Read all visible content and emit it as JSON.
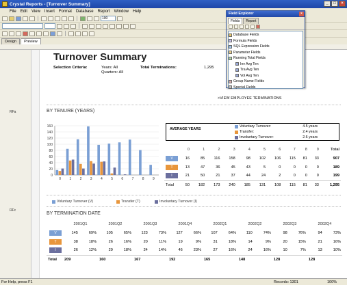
{
  "window": {
    "title": "Crystal Reports - [Turnover Summary]"
  },
  "menu": [
    "File",
    "Edit",
    "View",
    "Insert",
    "Format",
    "Database",
    "Report",
    "Window",
    "Help"
  ],
  "toolbar": {
    "zoom_value": "100"
  },
  "tabs": [
    "Design",
    "Preview"
  ],
  "side_labels": {
    "rfa": "RFa",
    "rfc": "RFc"
  },
  "report": {
    "title": "Turnover Summary",
    "criteria_label": "Selection Criteria:",
    "years": "Years: All",
    "quarters": "Quarters: All",
    "total_term_label": "Total Terminations:",
    "total_term_value": "1,295",
    "view_link": ">VIEW EMPLOYEE TERMINATIONS",
    "tenure_heading": "BY TENURE (YEARS)",
    "termdate_heading": "BY TERMINATION DATE"
  },
  "average": {
    "title": "AVERAGE YEARS",
    "rows": [
      {
        "label": "Voluntary Turnover:",
        "value": "4.5 years"
      },
      {
        "label": "Transfer:",
        "value": "2.4 years"
      },
      {
        "label": "Involuntary Turnover:",
        "value": "2.6 years"
      }
    ]
  },
  "tenure_table": {
    "headers": [
      "0",
      "1",
      "2",
      "3",
      "4",
      "5",
      "6",
      "7",
      "8",
      "9",
      "Total"
    ],
    "rows": [
      {
        "cat": "V",
        "values": [
          "16",
          "85",
          "116",
          "158",
          "98",
          "102",
          "106",
          "115",
          "81",
          "33",
          "907"
        ]
      },
      {
        "cat": "T",
        "values": [
          "13",
          "47",
          "36",
          "45",
          "43",
          "5",
          "0",
          "0",
          "0",
          "0",
          "189"
        ]
      },
      {
        "cat": "I",
        "values": [
          "21",
          "50",
          "21",
          "37",
          "44",
          "24",
          "2",
          "0",
          "0",
          "0",
          "199"
        ]
      }
    ],
    "total_label": "Total",
    "totals": [
      "50",
      "182",
      "173",
      "240",
      "185",
      "131",
      "108",
      "115",
      "81",
      "33",
      "1,295"
    ]
  },
  "legend": [
    {
      "label": "Voluntary Turnover (V)",
      "color": "#7a9fd4"
    },
    {
      "label": "Transfer (T)",
      "color": "#e8963c"
    },
    {
      "label": "Involuntary Turnover (I)",
      "color": "#6b6f9e"
    }
  ],
  "date_table": {
    "headers": [
      "2001Q1",
      "2001Q2",
      "2001Q3",
      "2001Q4",
      "2002Q1",
      "2002Q2",
      "2002Q3",
      "2002Q4"
    ],
    "rows": [
      {
        "cat": "V",
        "values": [
          [
            "145",
            "69%"
          ],
          [
            "105",
            "65%"
          ],
          [
            "123",
            "73%"
          ],
          [
            "127",
            "66%"
          ],
          [
            "107",
            "64%"
          ],
          [
            "110",
            "74%"
          ],
          [
            "98",
            "76%"
          ],
          [
            "94",
            "73%"
          ]
        ]
      },
      {
        "cat": "T",
        "values": [
          [
            "38",
            "18%"
          ],
          [
            "26",
            "16%"
          ],
          [
            "20",
            "11%"
          ],
          [
            "19",
            "9%"
          ],
          [
            "31",
            "18%"
          ],
          [
            "14",
            "9%"
          ],
          [
            "20",
            "15%"
          ],
          [
            "21",
            "16%"
          ]
        ]
      },
      {
        "cat": "I",
        "values": [
          [
            "26",
            "12%"
          ],
          [
            "29",
            "18%"
          ],
          [
            "24",
            "14%"
          ],
          [
            "46",
            "23%"
          ],
          [
            "27",
            "16%"
          ],
          [
            "24",
            "16%"
          ],
          [
            "10",
            "7%"
          ],
          [
            "13",
            "10%"
          ]
        ]
      }
    ],
    "total_label": "Total",
    "totals": [
      "209",
      "160",
      "167",
      "192",
      "165",
      "148",
      "128",
      "128"
    ]
  },
  "field_explorer": {
    "title": "Field Explorer",
    "tabs": [
      "Fields",
      "Report"
    ],
    "items": [
      "Database Fields",
      "Formula Fields",
      "SQL Expression Fields",
      "Parameter Fields",
      "Running Total Fields",
      "Inv Avg Ten",
      "Tra Avg Ten",
      "Vol Avg Ten",
      "Group Name Fields",
      "Special Fields"
    ]
  },
  "status": {
    "left": "For Help, press F1",
    "records": "Records: 1301",
    "zoom": "100%"
  },
  "chart_data": {
    "type": "bar",
    "categories": [
      "0",
      "1",
      "2",
      "3",
      "4",
      "5",
      "6",
      "7",
      "8",
      "9"
    ],
    "ylim": [
      0,
      160
    ],
    "yticks": [
      0,
      20,
      40,
      60,
      80,
      100,
      120,
      140,
      160
    ],
    "series": [
      {
        "name": "Voluntary Turnover (V)",
        "color": "#7a9fd4",
        "values": [
          16,
          85,
          116,
          158,
          98,
          102,
          106,
          115,
          81,
          33
        ]
      },
      {
        "name": "Transfer (T)",
        "color": "#e8963c",
        "values": [
          13,
          47,
          36,
          45,
          43,
          5,
          0,
          0,
          0,
          0
        ]
      },
      {
        "name": "Involuntary Turnover (I)",
        "color": "#6b6f9e",
        "values": [
          21,
          50,
          21,
          37,
          44,
          24,
          2,
          0,
          0,
          0
        ]
      }
    ]
  }
}
